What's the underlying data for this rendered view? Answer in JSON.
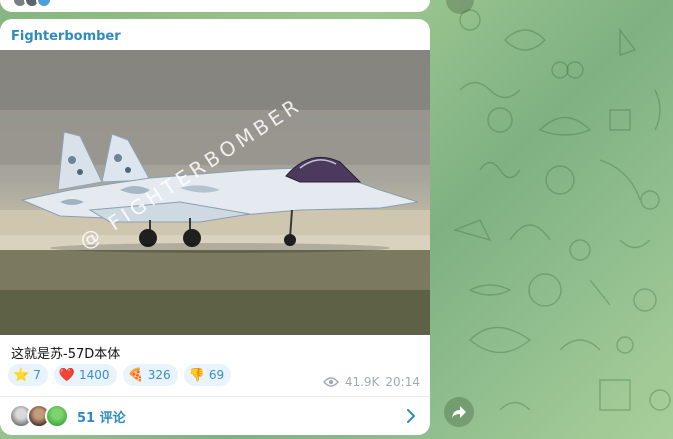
{
  "channel": {
    "name": "Fighterbomber"
  },
  "photo": {
    "watermark": "@ FIGHTERBOMBER"
  },
  "message": {
    "caption": "这就是苏-57D本体"
  },
  "reactions": [
    {
      "emoji": "⭐",
      "count": "7"
    },
    {
      "emoji": "❤️",
      "count": "1400"
    },
    {
      "emoji": "🍕",
      "count": "326"
    },
    {
      "emoji": "👎",
      "count": "69"
    }
  ],
  "meta": {
    "views": "41.9K",
    "time": "20:14"
  },
  "comments": {
    "label": "51 评论"
  },
  "colors": {
    "accent": "#2f8bbd",
    "reaction_bg": "#e8f3fb",
    "meta": "#a1aab3"
  }
}
